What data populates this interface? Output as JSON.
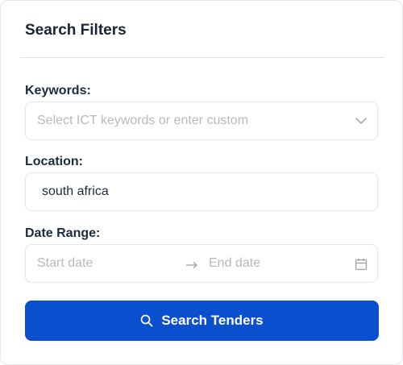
{
  "panel": {
    "title": "Search Filters"
  },
  "keywords": {
    "label": "Keywords:",
    "placeholder": "Select ICT keywords or enter custom",
    "dropdown_icon": "chevron-down-icon"
  },
  "location": {
    "label": "Location:",
    "value": "south africa"
  },
  "date_range": {
    "label": "Date Range:",
    "start_placeholder": "Start date",
    "end_placeholder": "End date",
    "separator_icon": "arrow-right-icon",
    "calendar_icon": "calendar-icon"
  },
  "search_button": {
    "label": "Search Tenders",
    "icon": "search-icon"
  },
  "colors": {
    "primary": "#0a4fce",
    "border": "#e2e5ea",
    "placeholder": "#b5b9c0",
    "text": "#1f2937"
  }
}
